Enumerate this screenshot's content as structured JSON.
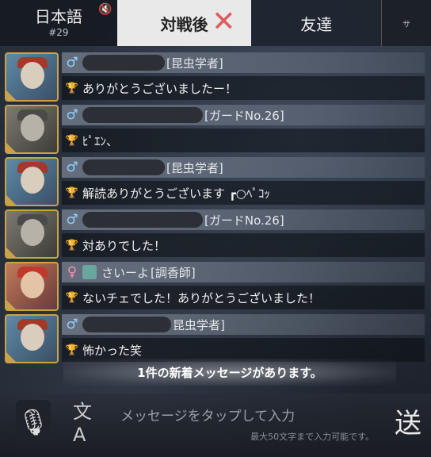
{
  "tabs": {
    "language": {
      "label": "日本語",
      "channel": "#29"
    },
    "after_match": {
      "label": "対戦後",
      "close_glyph": "✕"
    },
    "friends": {
      "label": "友達"
    },
    "extra": {
      "label": "サ"
    }
  },
  "messages": [
    {
      "gender": "♂",
      "role": "[昆虫学者]",
      "text": "ありがとうございましたー！",
      "avatar": "entomologist"
    },
    {
      "gender": "♂",
      "role": "[ガードNo.26]",
      "text": "ﾋﾟｴﾝ、",
      "avatar": "guard"
    },
    {
      "gender": "♂",
      "role": "[昆虫学者]",
      "text": "解読ありがとうございます ┏○ﾍﾟｺｯ",
      "avatar": "entomologist"
    },
    {
      "gender": "♂",
      "role": "[ガードNo.26]",
      "text": "対ありでした！",
      "avatar": "guard"
    },
    {
      "gender": "♀",
      "name": "さいーよ",
      "role": "[調香師]",
      "text": "ないチェでした！ありがとうございました！",
      "avatar": "perfumer"
    },
    {
      "gender": "♂",
      "role": "昆虫学者]",
      "text": "怖かった笑",
      "avatar": "entomologist"
    }
  ],
  "new_message_notice": "1件の新着メッセージがあります。",
  "input": {
    "placeholder": "メッセージをタップして入力",
    "limit": "最大50文字まで入力可能です。"
  },
  "send_label": "送",
  "colors": {
    "male": "#8fd0ff",
    "female": "#ff8ab0",
    "trophy": "#d58a3a",
    "avatar_frame": "#c9a24a"
  }
}
